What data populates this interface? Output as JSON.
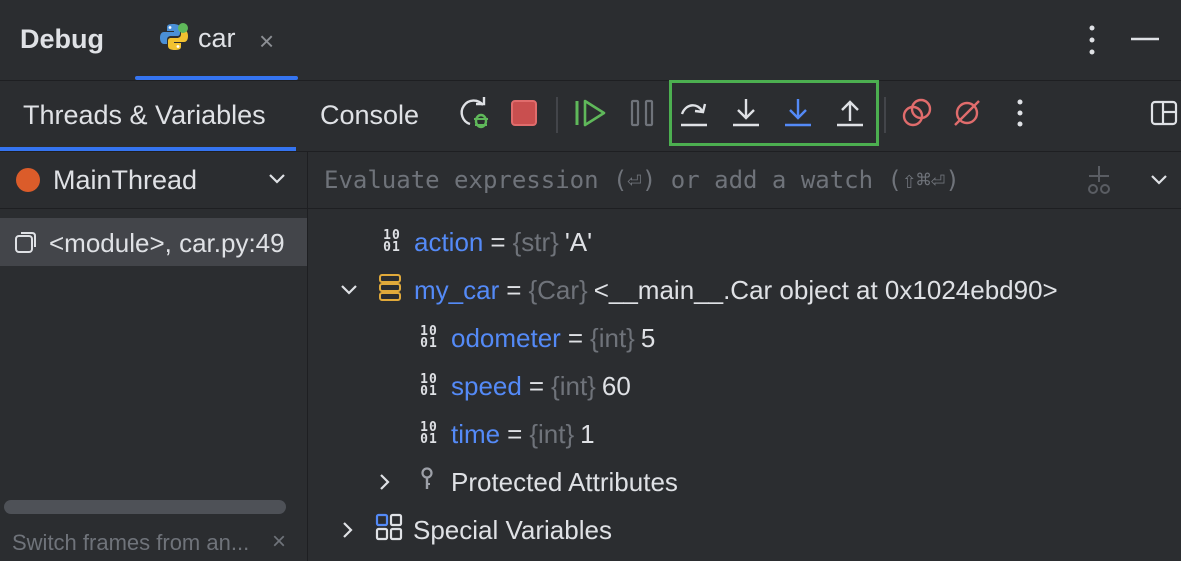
{
  "title_bar": {
    "debug_label": "Debug",
    "tab_label": "car",
    "tab_icon": "python-icon",
    "close_glyph": "×"
  },
  "toolbar": {
    "tabs": [
      {
        "label": "Threads & Variables",
        "selected": true
      },
      {
        "label": "Console",
        "selected": false
      }
    ],
    "buttons": [
      {
        "name": "rerun-button",
        "icon": "rerun-debug-icon"
      },
      {
        "name": "stop-button",
        "icon": "stop-icon"
      },
      {
        "name": "resume-button",
        "icon": "resume-icon"
      },
      {
        "name": "pause-button",
        "icon": "pause-icon"
      },
      {
        "name": "step-over-button",
        "icon": "step-over-icon"
      },
      {
        "name": "step-into-button",
        "icon": "step-into-icon"
      },
      {
        "name": "step-into-my-code-button",
        "icon": "step-into-my-code-icon"
      },
      {
        "name": "step-out-button",
        "icon": "step-out-icon"
      },
      {
        "name": "view-breakpoints-button",
        "icon": "view-breakpoints-icon"
      },
      {
        "name": "mute-breakpoints-button",
        "icon": "mute-breakpoints-icon"
      },
      {
        "name": "more-button",
        "icon": "kebab-icon"
      },
      {
        "name": "layout-button",
        "icon": "layout-icon"
      }
    ],
    "highlight_color": "#4caf50"
  },
  "threads": {
    "selected_thread": "MainThread",
    "frames": [
      {
        "label": "<module>, car.py:49"
      }
    ],
    "hint": "Switch frames from an...",
    "hint_close": "×"
  },
  "evaluate": {
    "placeholder": "Evaluate expression (⏎) or add a watch (⇧⌘⏎)"
  },
  "variables": [
    {
      "name": "action",
      "type": "{str}",
      "value": "'A'",
      "icon": "binary-icon"
    },
    {
      "name": "my_car",
      "type": "{Car}",
      "value": "<__main__.Car object at 0x1024ebd90>",
      "icon": "object-icon",
      "expanded": true
    },
    {
      "name": "odometer",
      "type": "{int}",
      "value": "5",
      "icon": "binary-icon"
    },
    {
      "name": "speed",
      "type": "{int}",
      "value": "60",
      "icon": "binary-icon"
    },
    {
      "name": "time",
      "type": "{int}",
      "value": "1",
      "icon": "binary-icon"
    },
    {
      "name": "Protected Attributes",
      "icon": "key-icon",
      "expanded": false
    },
    {
      "name": "Special Variables",
      "icon": "grid-icon",
      "expanded": false
    }
  ],
  "colors": {
    "accent": "#3574f0",
    "thread_dot": "#db5c2a",
    "var_name": "#548af7",
    "type_text": "#6f737a"
  }
}
